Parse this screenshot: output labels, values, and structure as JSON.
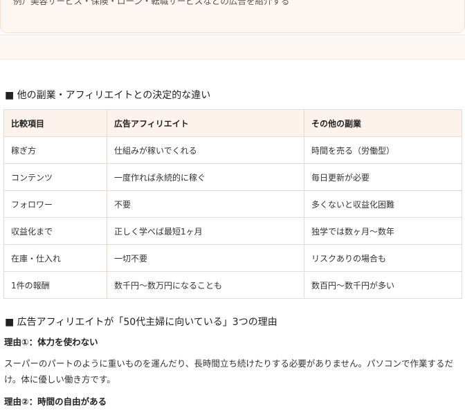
{
  "top_card": {
    "clipped_text": "例）美容サービス・保険・ローン・転職サービスなどの広告を紹介する"
  },
  "section1": {
    "heading": "■ 他の副業・アフィリエイトとの決定的な違い",
    "table": {
      "headers": [
        "比較項目",
        "広告アフィリエイト",
        "その他の副業"
      ],
      "rows": [
        [
          "稼ぎ方",
          "仕組みが稼いでくれる",
          "時間を売る（労働型）"
        ],
        [
          "コンテンツ",
          "一度作れば永続的に稼ぐ",
          "毎日更新が必要"
        ],
        [
          "フォロワー",
          "不要",
          "多くないと収益化困難"
        ],
        [
          "収益化まで",
          "正しく学べば最短1ヶ月",
          "独学では数ヶ月〜数年"
        ],
        [
          "在庫・仕入れ",
          "一切不要",
          "リスクありの場合も"
        ],
        [
          "1件の報酬",
          "数千円〜数万円になることも",
          "数百円〜数千円が多い"
        ]
      ]
    }
  },
  "section2": {
    "heading": "■ 広告アフィリエイトが「50代主婦に向いている」3つの理由",
    "reason1_title": "理由①：体力を使わない",
    "reason1_body": "スーパーのパートのように重いものを運んだり、長時間立ち続けたりする必要がありません。パソコンで作業するだけ。体に優しい働き方です。",
    "reason2_title": "理由②：時間の自由がある"
  }
}
